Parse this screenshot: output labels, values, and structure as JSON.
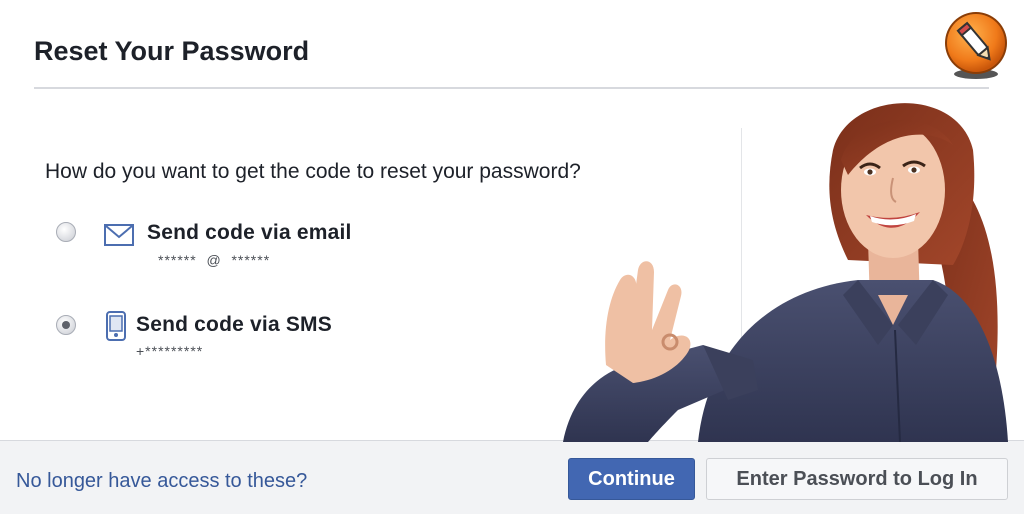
{
  "dialog": {
    "title": "Reset Your Password",
    "question": "How do you want to get the code to reset your password?"
  },
  "options": [
    {
      "label": "Send code via email",
      "masked": "******  @  ******",
      "icon": "mail-icon",
      "selected": false
    },
    {
      "label": "Send code via SMS",
      "masked": "+*********",
      "icon": "phone-icon",
      "selected": true
    }
  ],
  "footer": {
    "link": "No longer have access to these?",
    "primary_button": "Continue",
    "secondary_button": "Enter Password to Log In"
  },
  "colors": {
    "primary": "#4267b2",
    "link": "#365899",
    "badge": "#f07a1a"
  },
  "overlay": {
    "badge_icon": "pencil-icon",
    "photo": "woman-ok-gesture"
  }
}
